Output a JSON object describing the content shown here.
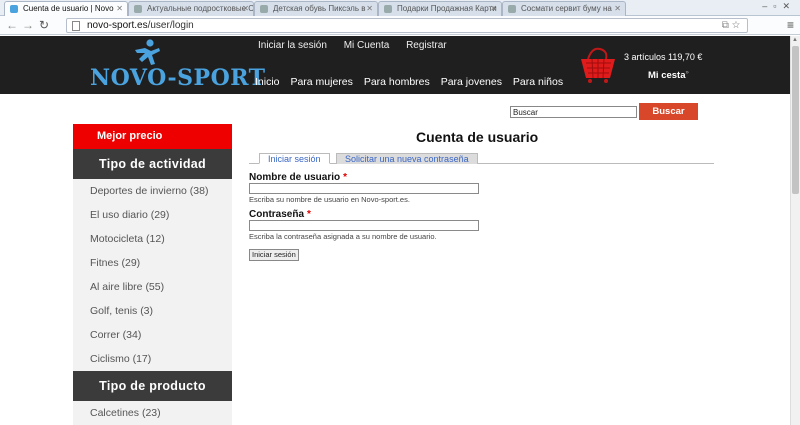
{
  "browser": {
    "tabs": [
      {
        "label": "Cuenta de usuario | Novo",
        "active": true
      },
      {
        "label": "Актуальные подростковые С",
        "active": false
      },
      {
        "label": "Детская обувь Пиксэль в",
        "active": false
      },
      {
        "label": "Подарки Продажная Карти",
        "active": false
      },
      {
        "label": "Сосмати сервит буму на",
        "active": false
      }
    ],
    "url_host": "novo-sport.es",
    "url_path": "/user/login"
  },
  "header": {
    "logo_text": "NOVO-SPORT",
    "top_links": [
      "Iniciar la sesión",
      "Mi Cuenta",
      "Registrar"
    ],
    "nav": [
      "Inicio",
      "Para mujeres",
      "Para hombres",
      "Para jovenes",
      "Para niños"
    ],
    "cart_count": "3 artículos 119,70 €",
    "cart_label": "Mi cesta"
  },
  "search": {
    "value": "Buscar",
    "button": "Buscar"
  },
  "sidebar": {
    "promo": "Mejor precio",
    "activity_title": "Tipo de actividad",
    "activities": [
      "Deportes de invierno (38)",
      "El uso diario (29)",
      "Motocicleta (12)",
      "Fitnes (29)",
      "Al aire libre (55)",
      "Golf, tenis (3)",
      "Correr (34)",
      "Ciclismo (17)"
    ],
    "product_title": "Tipo de producto",
    "products": [
      "Calcetines (23)"
    ]
  },
  "main": {
    "title": "Cuenta de usuario",
    "tabs": [
      "Iniciar sesión",
      "Solicitar una nueva contraseña"
    ],
    "username_label": "Nombre de usuario",
    "username_help": "Escriba su nombre de usuario en Novo-sport.es.",
    "password_label": "Contraseña",
    "password_help": "Escriba la contraseña asignada a su nombre de usuario.",
    "required_mark": "*",
    "submit": "Iniciar sesión"
  },
  "colors": {
    "accent_red": "#ef0000",
    "search_button": "#d9472a",
    "header_bg": "#1f1f1f",
    "logo": "#4aa3df",
    "link": "#3a66c4"
  }
}
